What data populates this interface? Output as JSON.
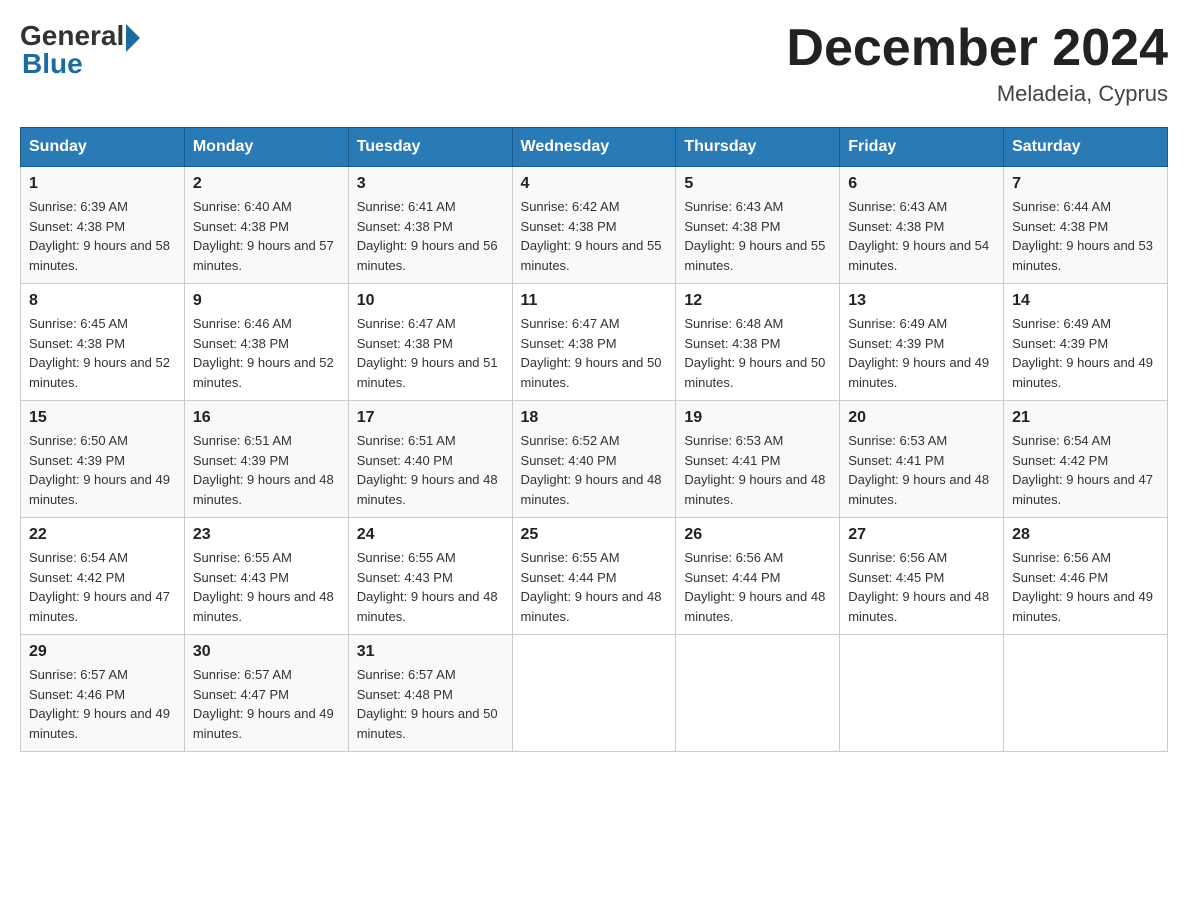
{
  "header": {
    "logo_general": "General",
    "logo_blue": "Blue",
    "month_title": "December 2024",
    "location": "Meladeia, Cyprus"
  },
  "weekdays": [
    "Sunday",
    "Monday",
    "Tuesday",
    "Wednesday",
    "Thursday",
    "Friday",
    "Saturday"
  ],
  "weeks": [
    [
      {
        "day": "1",
        "sunrise": "6:39 AM",
        "sunset": "4:38 PM",
        "daylight": "9 hours and 58 minutes."
      },
      {
        "day": "2",
        "sunrise": "6:40 AM",
        "sunset": "4:38 PM",
        "daylight": "9 hours and 57 minutes."
      },
      {
        "day": "3",
        "sunrise": "6:41 AM",
        "sunset": "4:38 PM",
        "daylight": "9 hours and 56 minutes."
      },
      {
        "day": "4",
        "sunrise": "6:42 AM",
        "sunset": "4:38 PM",
        "daylight": "9 hours and 55 minutes."
      },
      {
        "day": "5",
        "sunrise": "6:43 AM",
        "sunset": "4:38 PM",
        "daylight": "9 hours and 55 minutes."
      },
      {
        "day": "6",
        "sunrise": "6:43 AM",
        "sunset": "4:38 PM",
        "daylight": "9 hours and 54 minutes."
      },
      {
        "day": "7",
        "sunrise": "6:44 AM",
        "sunset": "4:38 PM",
        "daylight": "9 hours and 53 minutes."
      }
    ],
    [
      {
        "day": "8",
        "sunrise": "6:45 AM",
        "sunset": "4:38 PM",
        "daylight": "9 hours and 52 minutes."
      },
      {
        "day": "9",
        "sunrise": "6:46 AM",
        "sunset": "4:38 PM",
        "daylight": "9 hours and 52 minutes."
      },
      {
        "day": "10",
        "sunrise": "6:47 AM",
        "sunset": "4:38 PM",
        "daylight": "9 hours and 51 minutes."
      },
      {
        "day": "11",
        "sunrise": "6:47 AM",
        "sunset": "4:38 PM",
        "daylight": "9 hours and 50 minutes."
      },
      {
        "day": "12",
        "sunrise": "6:48 AM",
        "sunset": "4:38 PM",
        "daylight": "9 hours and 50 minutes."
      },
      {
        "day": "13",
        "sunrise": "6:49 AM",
        "sunset": "4:39 PM",
        "daylight": "9 hours and 49 minutes."
      },
      {
        "day": "14",
        "sunrise": "6:49 AM",
        "sunset": "4:39 PM",
        "daylight": "9 hours and 49 minutes."
      }
    ],
    [
      {
        "day": "15",
        "sunrise": "6:50 AM",
        "sunset": "4:39 PM",
        "daylight": "9 hours and 49 minutes."
      },
      {
        "day": "16",
        "sunrise": "6:51 AM",
        "sunset": "4:39 PM",
        "daylight": "9 hours and 48 minutes."
      },
      {
        "day": "17",
        "sunrise": "6:51 AM",
        "sunset": "4:40 PM",
        "daylight": "9 hours and 48 minutes."
      },
      {
        "day": "18",
        "sunrise": "6:52 AM",
        "sunset": "4:40 PM",
        "daylight": "9 hours and 48 minutes."
      },
      {
        "day": "19",
        "sunrise": "6:53 AM",
        "sunset": "4:41 PM",
        "daylight": "9 hours and 48 minutes."
      },
      {
        "day": "20",
        "sunrise": "6:53 AM",
        "sunset": "4:41 PM",
        "daylight": "9 hours and 48 minutes."
      },
      {
        "day": "21",
        "sunrise": "6:54 AM",
        "sunset": "4:42 PM",
        "daylight": "9 hours and 47 minutes."
      }
    ],
    [
      {
        "day": "22",
        "sunrise": "6:54 AM",
        "sunset": "4:42 PM",
        "daylight": "9 hours and 47 minutes."
      },
      {
        "day": "23",
        "sunrise": "6:55 AM",
        "sunset": "4:43 PM",
        "daylight": "9 hours and 48 minutes."
      },
      {
        "day": "24",
        "sunrise": "6:55 AM",
        "sunset": "4:43 PM",
        "daylight": "9 hours and 48 minutes."
      },
      {
        "day": "25",
        "sunrise": "6:55 AM",
        "sunset": "4:44 PM",
        "daylight": "9 hours and 48 minutes."
      },
      {
        "day": "26",
        "sunrise": "6:56 AM",
        "sunset": "4:44 PM",
        "daylight": "9 hours and 48 minutes."
      },
      {
        "day": "27",
        "sunrise": "6:56 AM",
        "sunset": "4:45 PM",
        "daylight": "9 hours and 48 minutes."
      },
      {
        "day": "28",
        "sunrise": "6:56 AM",
        "sunset": "4:46 PM",
        "daylight": "9 hours and 49 minutes."
      }
    ],
    [
      {
        "day": "29",
        "sunrise": "6:57 AM",
        "sunset": "4:46 PM",
        "daylight": "9 hours and 49 minutes."
      },
      {
        "day": "30",
        "sunrise": "6:57 AM",
        "sunset": "4:47 PM",
        "daylight": "9 hours and 49 minutes."
      },
      {
        "day": "31",
        "sunrise": "6:57 AM",
        "sunset": "4:48 PM",
        "daylight": "9 hours and 50 minutes."
      },
      null,
      null,
      null,
      null
    ]
  ]
}
